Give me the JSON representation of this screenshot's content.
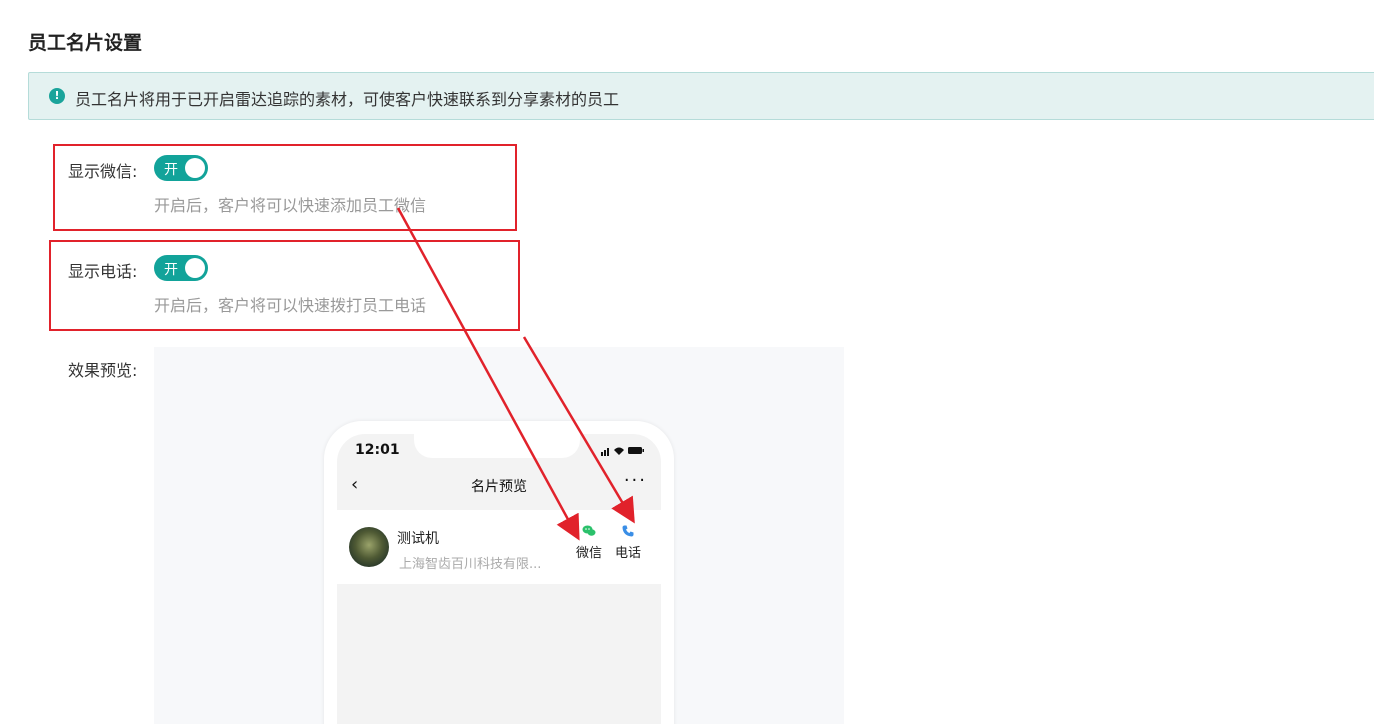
{
  "page": {
    "title": "员工名片设置"
  },
  "notice": {
    "icon": "info-icon",
    "text": "员工名片将用于已开启雷达追踪的素材，可使客户快速联系到分享素材的员工"
  },
  "fields": {
    "wechat": {
      "label": "显示微信:",
      "toggle_text": "开",
      "enabled": true,
      "hint": "开启后，客户将可以快速添加员工微信"
    },
    "phone": {
      "label": "显示电话:",
      "toggle_text": "开",
      "enabled": true,
      "hint": "开启后，客户将可以快速拨打员工电话"
    }
  },
  "preview": {
    "label": "效果预览:",
    "status_time": "12:01",
    "nav_title": "名片预览",
    "card": {
      "name": "测试机",
      "company": "上海智齿百川科技有限...",
      "wechat_label": "微信",
      "phone_label": "电话"
    }
  },
  "colors": {
    "accent": "#12a39a",
    "annotation": "#e1222b",
    "wechat_icon": "#2bc16b",
    "phone_icon": "#3a8ee6"
  }
}
